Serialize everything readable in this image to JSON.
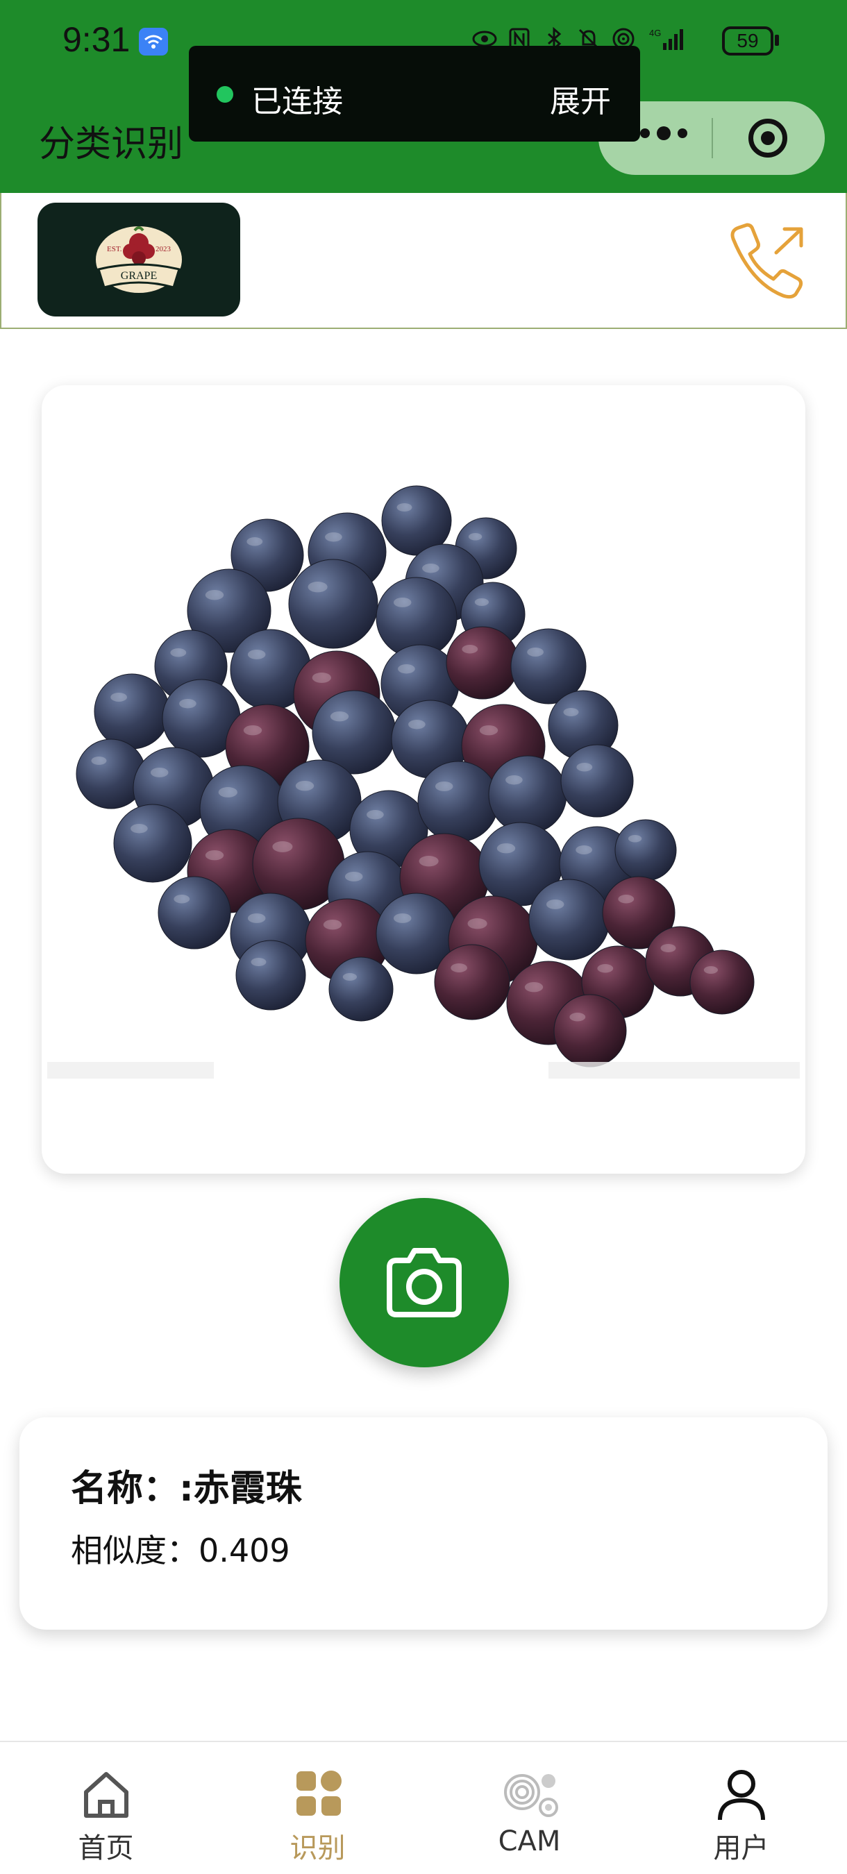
{
  "status_bar": {
    "time": "9:31",
    "battery": "59",
    "icons": [
      "wifi-badge-icon",
      "eye-icon",
      "nfc-icon",
      "bluetooth-icon",
      "mute-icon",
      "hotspot-icon",
      "signal-4g-icon"
    ]
  },
  "toast": {
    "status": "已连接",
    "expand": "展开",
    "dot_color": "#22c55e"
  },
  "nav": {
    "title": "分类识别"
  },
  "brand": {
    "logo_text": "GRAPE",
    "logo_est": "EST.",
    "logo_year": "2023",
    "accent_color": "#e5a23a"
  },
  "image_card": {
    "description_icon": "grape-photo"
  },
  "result": {
    "name": "名称：:赤霞珠",
    "similarity": "相似度：0.409"
  },
  "tabs": [
    {
      "label": "首页",
      "icon": "home-icon",
      "active": false
    },
    {
      "label": "识别",
      "icon": "grid-icon",
      "active": true
    },
    {
      "label": "CAM",
      "icon": "cam-icon",
      "active": false
    },
    {
      "label": "用户",
      "icon": "user-icon",
      "active": false
    }
  ],
  "colors": {
    "primary_green": "#1e8b2a",
    "active_tab": "#b8995b"
  }
}
